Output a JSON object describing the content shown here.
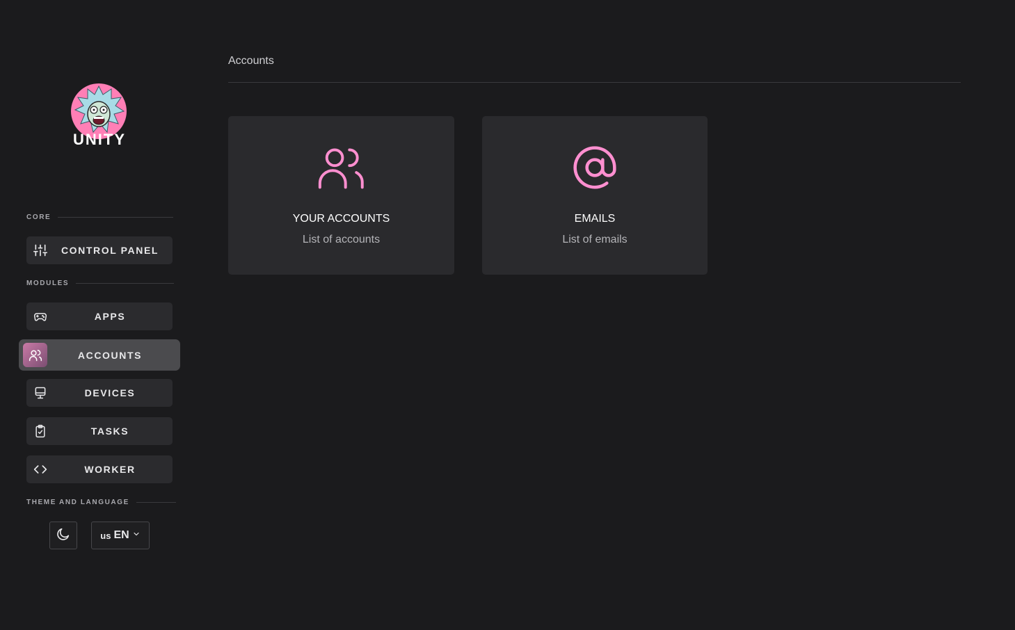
{
  "brand": {
    "name": "UNITY"
  },
  "sidebar": {
    "sections": {
      "core": "CORE",
      "modules": "MODULES",
      "theme_language": "THEME AND LANGUAGE"
    },
    "items": [
      {
        "label": "CONTROL PANEL",
        "icon": "sliders-icon"
      },
      {
        "label": "APPS",
        "icon": "gamepad-icon"
      },
      {
        "label": "ACCOUNTS",
        "icon": "users-icon",
        "active": true
      },
      {
        "label": "DEVICES",
        "icon": "monitor-icon"
      },
      {
        "label": "TASKS",
        "icon": "clipboard-check-icon"
      },
      {
        "label": "WORKER",
        "icon": "code-icon"
      }
    ],
    "theme_icon": "moon-icon",
    "language": {
      "flag": "us",
      "code": "EN"
    }
  },
  "main": {
    "title": "Accounts",
    "cards": [
      {
        "title": "YOUR ACCOUNTS",
        "subtitle": "List of accounts",
        "icon": "users-icon"
      },
      {
        "title": "EMAILS",
        "subtitle": "List of emails",
        "icon": "at-sign-icon"
      }
    ]
  },
  "colors": {
    "background": "#1b1b1d",
    "card": "#2a2a2d",
    "accent": "#ff8fd0",
    "active_item": "#4b4b4e"
  }
}
